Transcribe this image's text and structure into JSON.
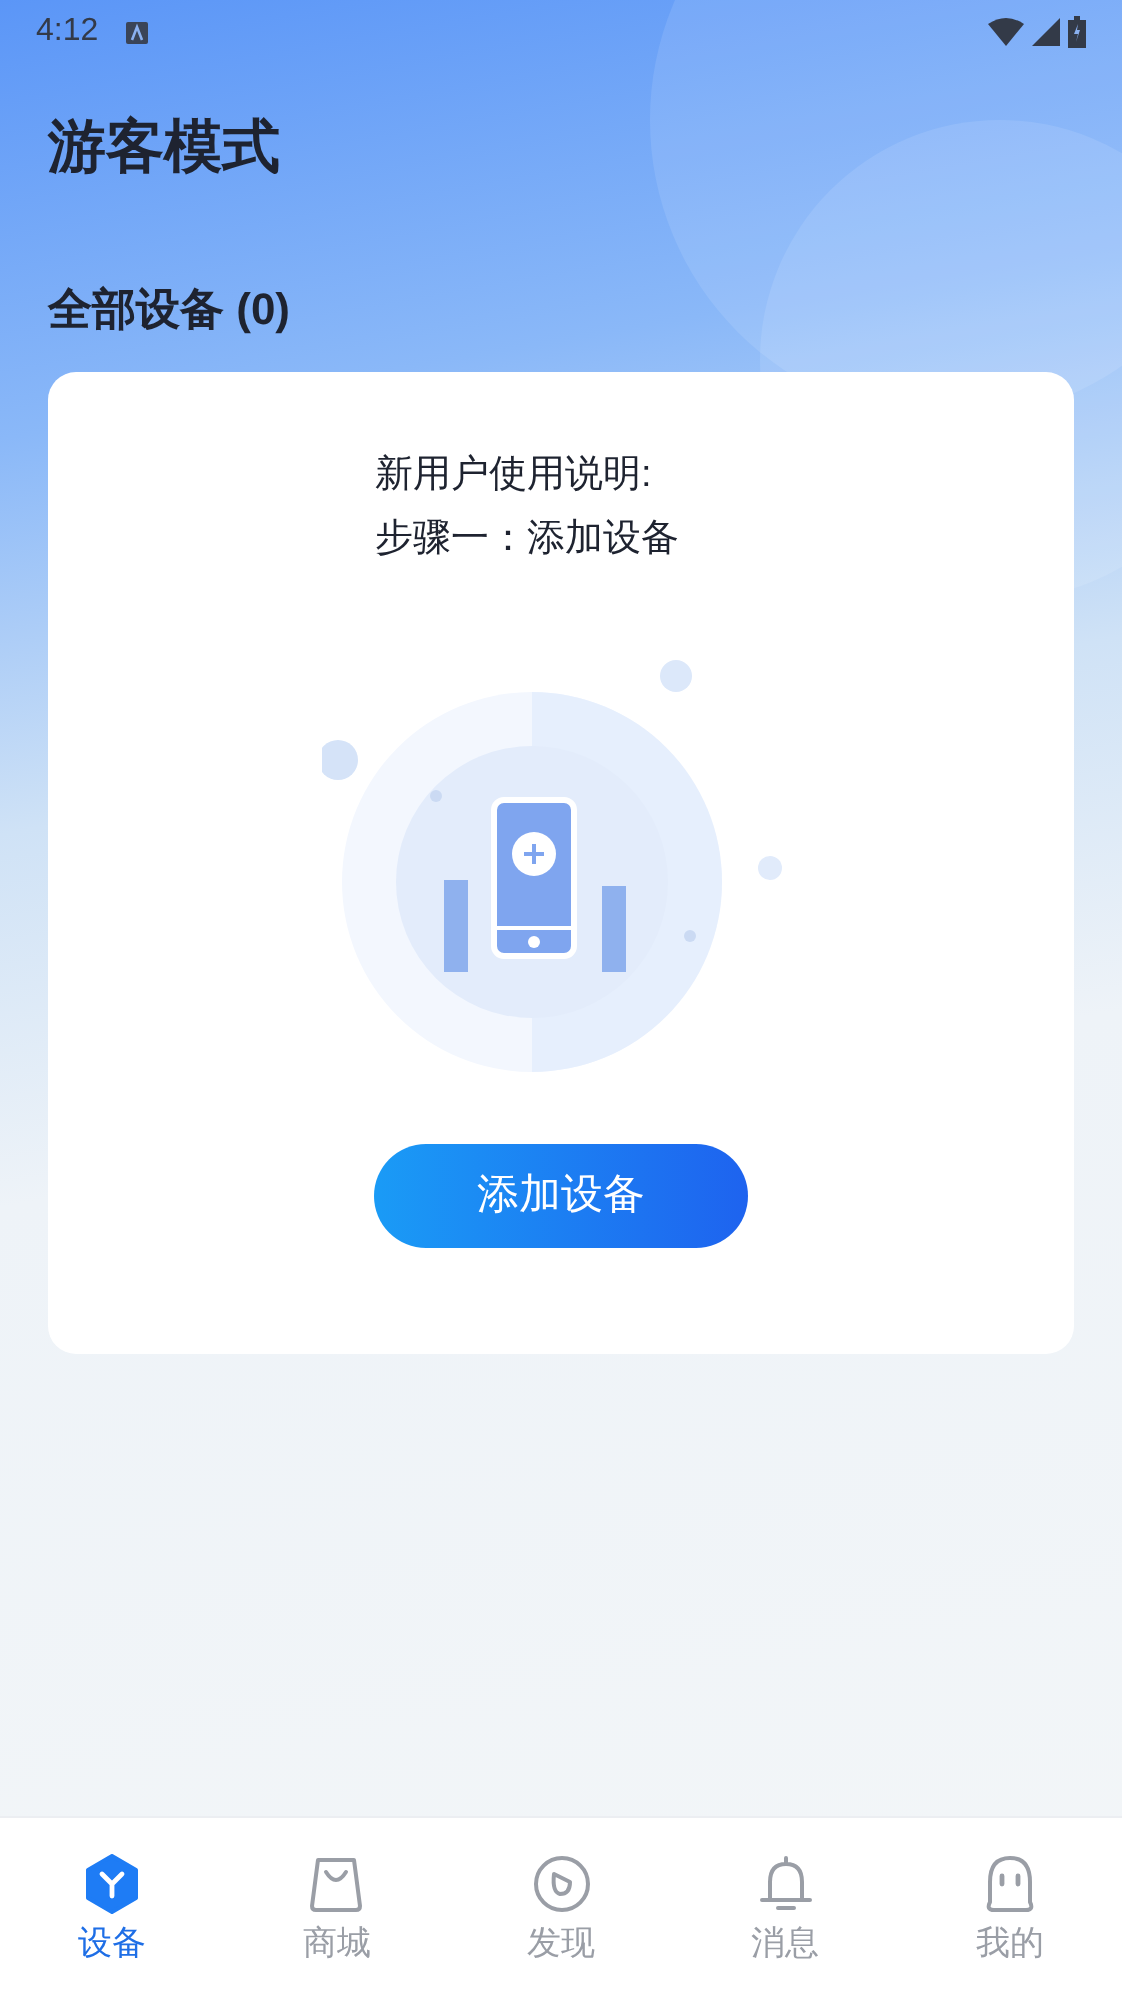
{
  "status_bar": {
    "time": "4:12"
  },
  "header": {
    "title": "游客模式"
  },
  "section": {
    "title": "全部设备 (0)"
  },
  "card": {
    "instructions": [
      "新用户使用说明:",
      "步骤一：添加设备"
    ],
    "button": "添加设备"
  },
  "tabs": [
    {
      "label": "设备",
      "kind": "device",
      "selected": true
    },
    {
      "label": "商城",
      "kind": "shop",
      "selected": false
    },
    {
      "label": "发现",
      "kind": "discover",
      "selected": false
    },
    {
      "label": "消息",
      "kind": "message",
      "selected": false
    },
    {
      "label": "我的",
      "kind": "me",
      "selected": false
    }
  ]
}
